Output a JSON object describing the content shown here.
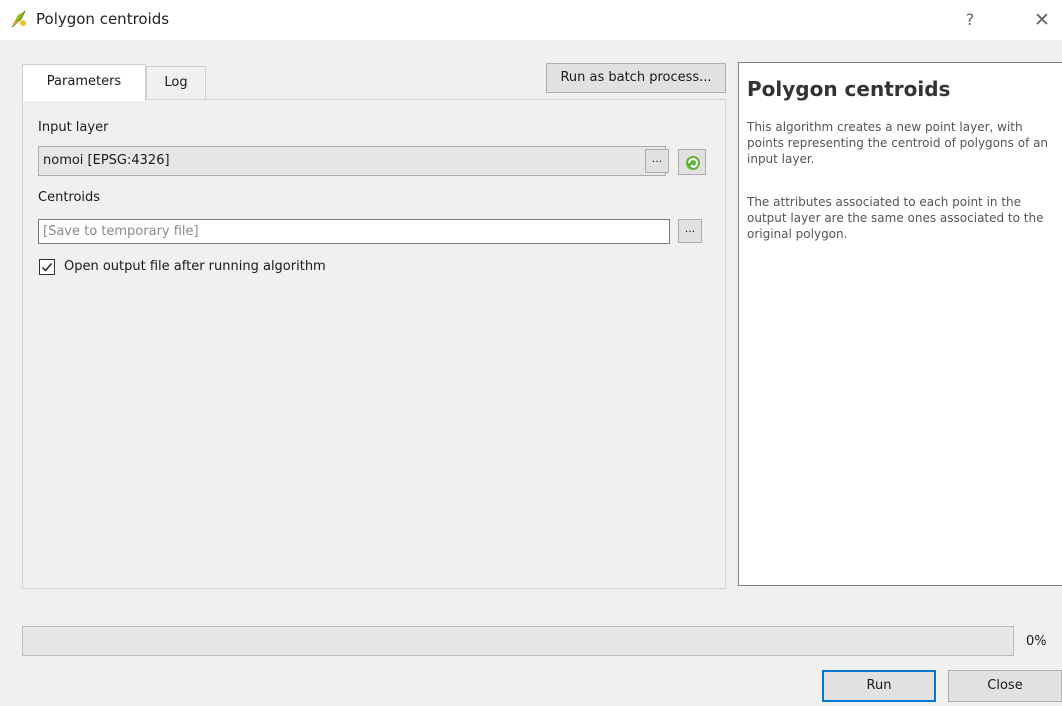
{
  "window": {
    "title": "Polygon centroids",
    "help_label": "?",
    "close_label": "✕"
  },
  "tabs": [
    {
      "label": "Parameters",
      "active": true
    },
    {
      "label": "Log",
      "active": false
    }
  ],
  "toolbar": {
    "batch_label": "Run as batch process..."
  },
  "params": {
    "input_layer_label": "Input layer",
    "input_layer_value": "nomoi [EPSG:4326]",
    "dots_label": "...",
    "centroids_label": "Centroids",
    "centroids_placeholder": "[Save to temporary file]",
    "open_output_label": "Open output file after running algorithm",
    "open_output_checked": true
  },
  "help": {
    "title": "Polygon centroids",
    "paragraphs": [
      "This algorithm creates a new point layer, with points representing the centroid of polygons of an input layer.",
      "The attributes associated to each point in the output layer are the same ones associated to the original polygon."
    ]
  },
  "progress": {
    "value": 0,
    "label": "0%"
  },
  "buttons": {
    "run": "Run",
    "close": "Close"
  },
  "colors": {
    "accent": "#0078d7",
    "progress": "#06b025"
  },
  "icons": {
    "app": "qgis-logo-icon",
    "iterate": "iterate-icon",
    "dropdown": "chevron-down-icon",
    "check": "check-icon"
  }
}
